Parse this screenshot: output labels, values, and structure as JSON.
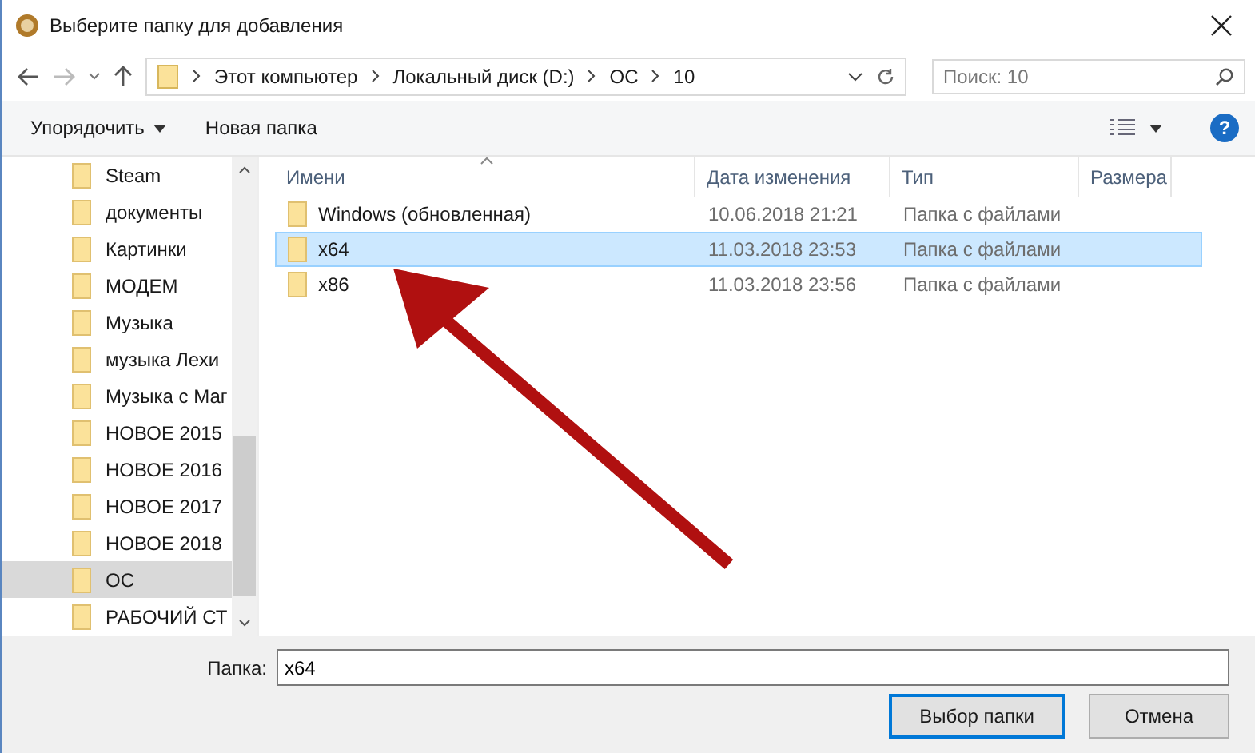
{
  "window": {
    "title": "Выберите папку для добавления"
  },
  "address_bar": {
    "segments": [
      "Этот компьютер",
      "Локальный диск (D:)",
      "OC",
      "10"
    ]
  },
  "search": {
    "placeholder": "Поиск: 10"
  },
  "toolbar": {
    "organize": "Упорядочить",
    "new_folder": "Новая папка",
    "help": "?"
  },
  "sidebar": {
    "items": [
      {
        "label": "Steam",
        "selected": false
      },
      {
        "label": "документы",
        "selected": false
      },
      {
        "label": "Картинки",
        "selected": false
      },
      {
        "label": "МОДЕМ",
        "selected": false
      },
      {
        "label": "Музыка",
        "selected": false
      },
      {
        "label": "музыка Лехи",
        "selected": false
      },
      {
        "label": "Музыка с Маг",
        "selected": false
      },
      {
        "label": "НОВОЕ 2015",
        "selected": false
      },
      {
        "label": "НОВОЕ 2016",
        "selected": false
      },
      {
        "label": "НОВОЕ 2017",
        "selected": false
      },
      {
        "label": "НОВОЕ 2018",
        "selected": false
      },
      {
        "label": "OC",
        "selected": true
      },
      {
        "label": "РАБОЧИЙ СТ",
        "selected": false
      }
    ]
  },
  "table": {
    "columns": [
      "Имени",
      "Дата изменения",
      "Тип",
      "Размера"
    ],
    "rows": [
      {
        "name": "Windows (обновленная)",
        "date": "10.06.2018 21:21",
        "type": "Папка с файлами",
        "selected": false
      },
      {
        "name": "x64",
        "date": "11.03.2018 23:53",
        "type": "Папка с файлами",
        "selected": true
      },
      {
        "name": "x86",
        "date": "11.03.2018 23:56",
        "type": "Папка с файлами",
        "selected": false
      }
    ]
  },
  "folder_field": {
    "label": "Папка:",
    "value": "x64"
  },
  "buttons": [
    "Выбор папки",
    "Отмена"
  ]
}
